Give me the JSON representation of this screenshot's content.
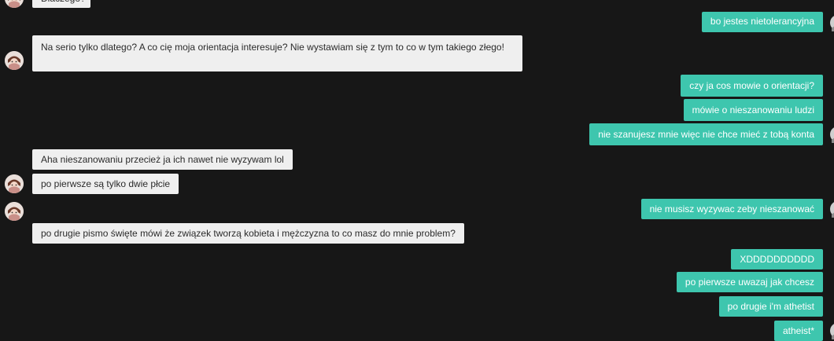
{
  "messages": [
    {
      "side": "in",
      "text": "Dlaczego?"
    },
    {
      "side": "out",
      "text": "bo jestes nietolerancyjna"
    },
    {
      "side": "in",
      "text": "Na serio tylko dlatego? A co cię moja orientacja interesuje? Nie wystawiam się z tym to co w tym takiego złego!"
    },
    {
      "side": "out",
      "text": "czy ja cos mowie o orientacji?"
    },
    {
      "side": "out",
      "text": "mówie o nieszanowaniu ludzi"
    },
    {
      "side": "out",
      "text": "nie szanujesz mnie więc nie chce mieć z tobą konta"
    },
    {
      "side": "in",
      "text": "Aha nieszanowaniu przecież ja ich nawet nie wyzywam lol"
    },
    {
      "side": "in",
      "text": "po pierwsze są tylko dwie płcie"
    },
    {
      "side": "out",
      "text": "nie musisz wyzywac zeby nieszanować"
    },
    {
      "side": "in",
      "text": "po drugie pismo święte mówi że związek tworzą kobieta i mężczyzna to co masz do mnie problem?"
    },
    {
      "side": "out",
      "text": "XDDDDDDDDDD"
    },
    {
      "side": "out",
      "text": "po pierwsze uwazaj jak chcesz"
    },
    {
      "side": "out",
      "text": "po drugie i'm athetist"
    },
    {
      "side": "out",
      "text": "atheist*"
    }
  ],
  "colors": {
    "background": "#171717",
    "incoming_bubble": "#efefef",
    "outgoing_bubble": "#3ec6ae"
  },
  "icons": {
    "contact_avatar": "avatar-icon",
    "own_avatar": "avatar-icon"
  }
}
